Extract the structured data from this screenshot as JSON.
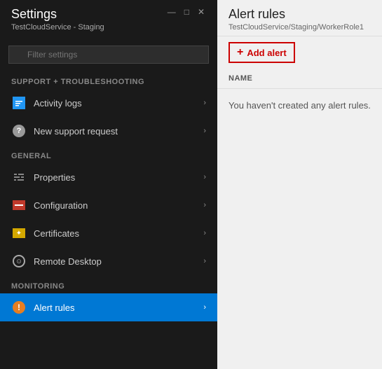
{
  "settings": {
    "title": "Settings",
    "subtitle": "TestCloudService - Staging",
    "window_controls": [
      "—",
      "□",
      "✕"
    ],
    "search": {
      "placeholder": "Filter settings"
    },
    "sections": [
      {
        "id": "support",
        "label": "SUPPORT + TROUBLESHOOTING",
        "items": [
          {
            "id": "activity-logs",
            "label": "Activity logs",
            "icon": "activity",
            "active": false
          },
          {
            "id": "new-support",
            "label": "New support request",
            "icon": "support",
            "active": false
          }
        ]
      },
      {
        "id": "general",
        "label": "GENERAL",
        "items": [
          {
            "id": "properties",
            "label": "Properties",
            "icon": "properties",
            "active": false
          },
          {
            "id": "configuration",
            "label": "Configuration",
            "icon": "config",
            "active": false
          },
          {
            "id": "certificates",
            "label": "Certificates",
            "icon": "cert",
            "active": false
          },
          {
            "id": "remote-desktop",
            "label": "Remote Desktop",
            "icon": "remote",
            "active": false
          }
        ]
      },
      {
        "id": "monitoring",
        "label": "MONITORING",
        "items": [
          {
            "id": "alert-rules",
            "label": "Alert rules",
            "icon": "alert",
            "active": true
          }
        ]
      }
    ]
  },
  "alert_rules": {
    "title": "Alert rules",
    "subtitle": "TestCloudService/Staging/WorkerRole1",
    "add_button_label": "Add alert",
    "table_header": "NAME",
    "empty_message": "You haven't created any alert rules."
  }
}
